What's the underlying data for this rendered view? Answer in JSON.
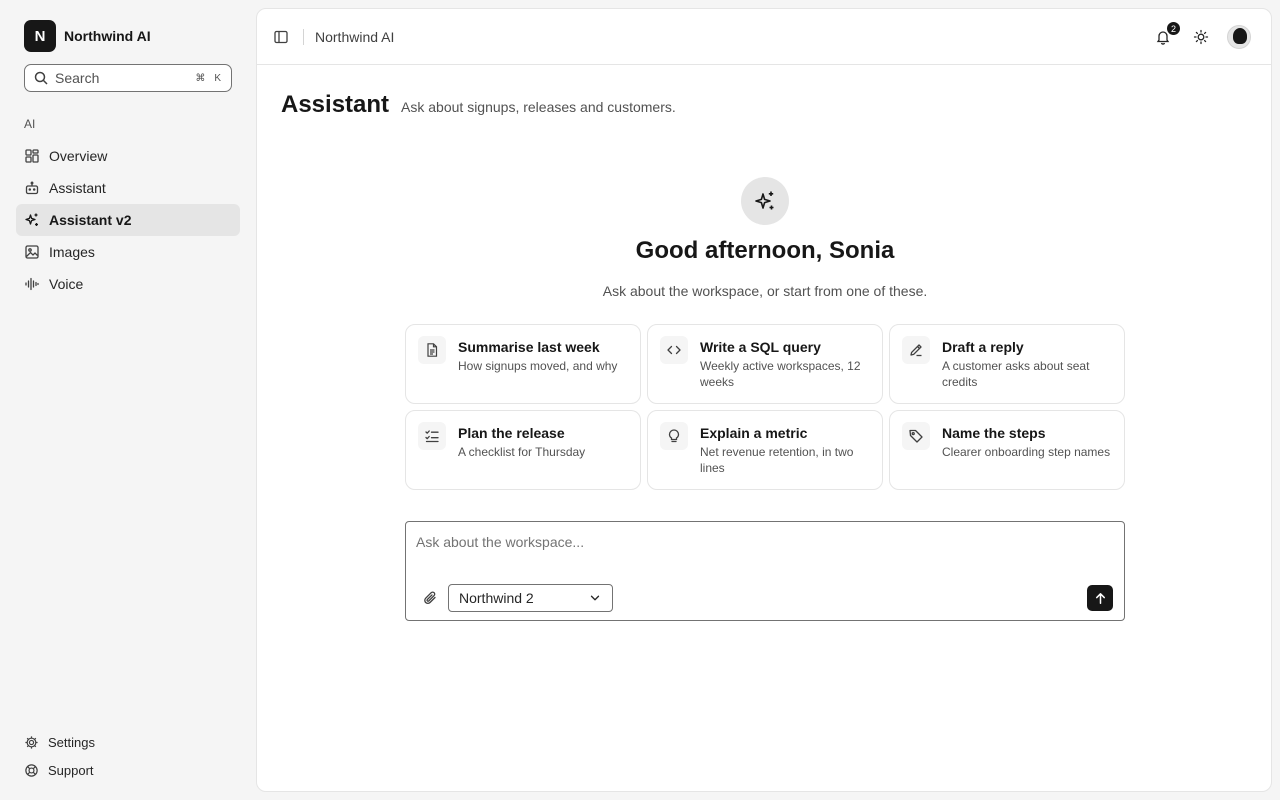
{
  "brand": {
    "logo_letter": "N",
    "name": "Northwind AI"
  },
  "search": {
    "label": "Search",
    "kbd_cmd": "⌘",
    "kbd_key": "K"
  },
  "sidebar": {
    "section_label": "AI",
    "items": [
      {
        "label": "Overview",
        "icon": "dashboard-icon"
      },
      {
        "label": "Assistant",
        "icon": "bot-icon"
      },
      {
        "label": "Assistant v2",
        "icon": "sparkles-icon",
        "active": true
      },
      {
        "label": "Images",
        "icon": "image-icon"
      },
      {
        "label": "Voice",
        "icon": "audio-wave-icon"
      }
    ],
    "bottom": [
      {
        "label": "Settings",
        "icon": "gear-icon"
      },
      {
        "label": "Support",
        "icon": "lifebuoy-icon"
      }
    ]
  },
  "header": {
    "breadcrumb": "Northwind AI",
    "notification_count": "2"
  },
  "page": {
    "title": "Assistant",
    "subtitle": "Ask about signups, releases and customers."
  },
  "hero": {
    "greeting": "Good afternoon, Sonia",
    "subtitle": "Ask about the workspace, or start from one of these."
  },
  "suggestions": [
    {
      "title": "Summarise last week",
      "desc": "How signups moved, and why",
      "icon": "document-icon"
    },
    {
      "title": "Write a SQL query",
      "desc": "Weekly active workspaces, 12 weeks",
      "icon": "code-icon"
    },
    {
      "title": "Draft a reply",
      "desc": "A customer asks about seat credits",
      "icon": "pencil-icon"
    },
    {
      "title": "Plan the release",
      "desc": "A checklist for Thursday",
      "icon": "checklist-icon"
    },
    {
      "title": "Explain a metric",
      "desc": "Net revenue retention, in two lines",
      "icon": "lightbulb-icon"
    },
    {
      "title": "Name the steps",
      "desc": "Clearer onboarding step names",
      "icon": "tag-icon"
    }
  ],
  "composer": {
    "placeholder": "Ask about the workspace...",
    "model": "Northwind 2"
  },
  "colors": {
    "accent": "#171717",
    "background": "#f5f5f5",
    "surface": "#ffffff",
    "active_nav": "#e5e5e5"
  }
}
